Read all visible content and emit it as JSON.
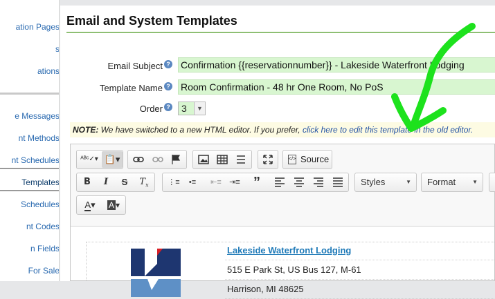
{
  "sidebar": {
    "items": [
      {
        "label": "ation Pages"
      },
      {
        "label": "s"
      },
      {
        "label": "ations"
      },
      {
        "label": "e Messages"
      },
      {
        "label": "nt Methods"
      },
      {
        "label": "nt Schedules"
      },
      {
        "label": "Templates"
      },
      {
        "label": "Schedules"
      },
      {
        "label": "nt Codes"
      },
      {
        "label": "n Fields"
      },
      {
        "label": "For Sale"
      }
    ]
  },
  "page": {
    "title": "Email and System Templates"
  },
  "form": {
    "email_subject_label": "Email Subject",
    "email_subject_value": "Confirmation {{reservationnumber}} - Lakeside Waterfront Lodging",
    "template_name_label": "Template Name",
    "template_name_value": "Room Confirmation - 48 hr One Room, No PoS",
    "order_label": "Order",
    "order_value": "3"
  },
  "note": {
    "prefix": "NOTE:",
    "text": " We have switched to a new HTML editor. If you prefer, ",
    "link": "click here to edit this template in the old editor."
  },
  "toolbar": {
    "source_label": "Source",
    "styles_label": "Styles",
    "format_label": "Format"
  },
  "content": {
    "business_name": "Lakeside Waterfront Lodging",
    "address_line": "515 E Park St, US Bus 127, M-61",
    "city_line": "Harrison, MI 48625"
  },
  "colors": {
    "accent_green": "#8ebf73",
    "field_green": "#d8f6d0",
    "link_blue": "#2453a3",
    "annotation_green": "#1de21d"
  },
  "icons": [
    "help-icon",
    "spellcheck-icon",
    "paste-icon",
    "link-icon",
    "unlink-icon",
    "flag-icon",
    "image-icon",
    "table-icon",
    "horizontal-rule-icon",
    "maximize-icon",
    "source-icon",
    "bold-icon",
    "italic-icon",
    "strikethrough-icon",
    "remove-format-icon",
    "numbered-list-icon",
    "bulleted-list-icon",
    "outdent-icon",
    "indent-icon",
    "blockquote-icon",
    "align-left-icon",
    "align-center-icon",
    "align-right-icon",
    "justify-icon",
    "text-color-icon",
    "background-color-icon"
  ]
}
